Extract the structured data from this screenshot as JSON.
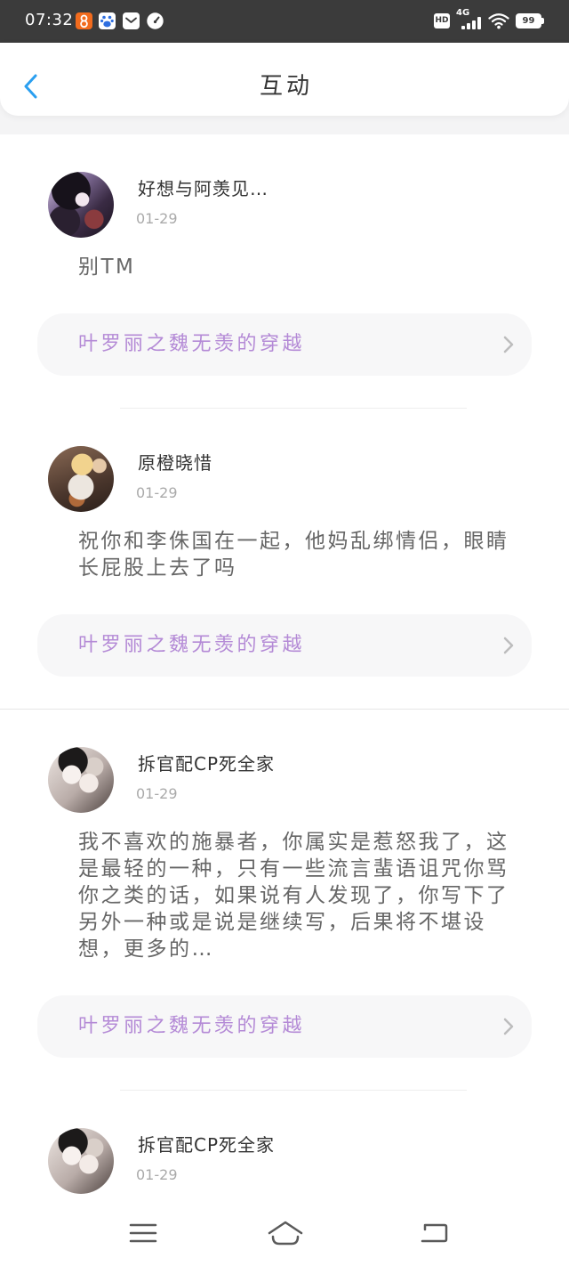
{
  "status_bar": {
    "time": "07:32",
    "notification_icons": [
      "orange-app-icon",
      "baidu-paw-icon",
      "mail-icon",
      "gauge-icon"
    ],
    "hd_label": "HD",
    "network_label": "4G",
    "signal_icon": "signal-bars-icon",
    "wifi_icon": "wifi-icon",
    "battery_level": "99"
  },
  "header": {
    "title": "互动",
    "back_icon": "chevron-left-icon"
  },
  "items": [
    {
      "name": "好想与阿羡见…",
      "date": "01-29",
      "content": "别TM",
      "work_title": "叶罗丽之魏无羡的穿越"
    },
    {
      "name": "原橙晓惜",
      "date": "01-29",
      "content": "祝你和李侏国在一起，他妈乱绑情侣，眼睛长屁股上去了吗",
      "work_title": "叶罗丽之魏无羡的穿越"
    },
    {
      "name": "拆官配CP死全家",
      "date": "01-29",
      "content": "我不喜欢的施暴者，你属实是惹怒我了，这是最轻的一种，只有一些流言蜚语诅咒你骂你之类的话，如果说有人发现了，你写下了另外一种或是说是继续写，后果将不堪设想，更多的…",
      "work_title": "叶罗丽之魏无羡的穿越"
    },
    {
      "name": "拆官配CP死全家",
      "date": "01-29"
    }
  ],
  "bottom_nav": {
    "icons": [
      "menu-icon",
      "home-icon",
      "back-arrow-icon"
    ]
  },
  "colors": {
    "status_bar_bg": "#3b3b3b",
    "accent": "#2a9ff0",
    "work_title_text": "#b48ad6",
    "body_text": "#666666",
    "date_text": "#aaaaaa"
  }
}
